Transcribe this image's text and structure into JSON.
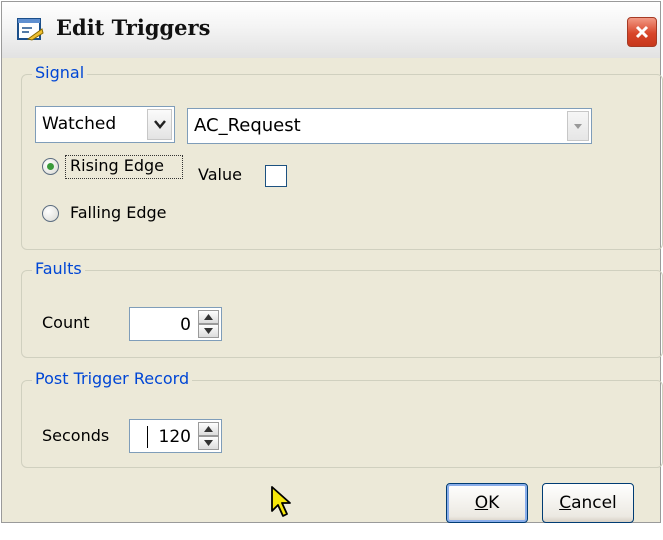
{
  "window": {
    "title": "Edit Triggers"
  },
  "signal": {
    "group_label": "Signal",
    "mode_select": {
      "value": "Watched"
    },
    "signal_select": {
      "value": "AC_Request"
    },
    "rising_edge_label": "Rising Edge",
    "falling_edge_label": "Falling Edge",
    "selected_edge": "rising",
    "value_label": "Value",
    "value_checked": false
  },
  "faults": {
    "group_label": "Faults",
    "count_label": "Count",
    "count_value": "0"
  },
  "post_trigger": {
    "group_label": "Post Trigger Record",
    "seconds_label": "Seconds",
    "seconds_value": "120"
  },
  "buttons": {
    "ok_mnemonic": "O",
    "ok_rest": "K",
    "cancel_mnemonic": "C",
    "cancel_rest": "ancel"
  },
  "colors": {
    "group_title": "#0046d5",
    "window_bg": "#ece9d8",
    "close_button": "#d8462a"
  }
}
